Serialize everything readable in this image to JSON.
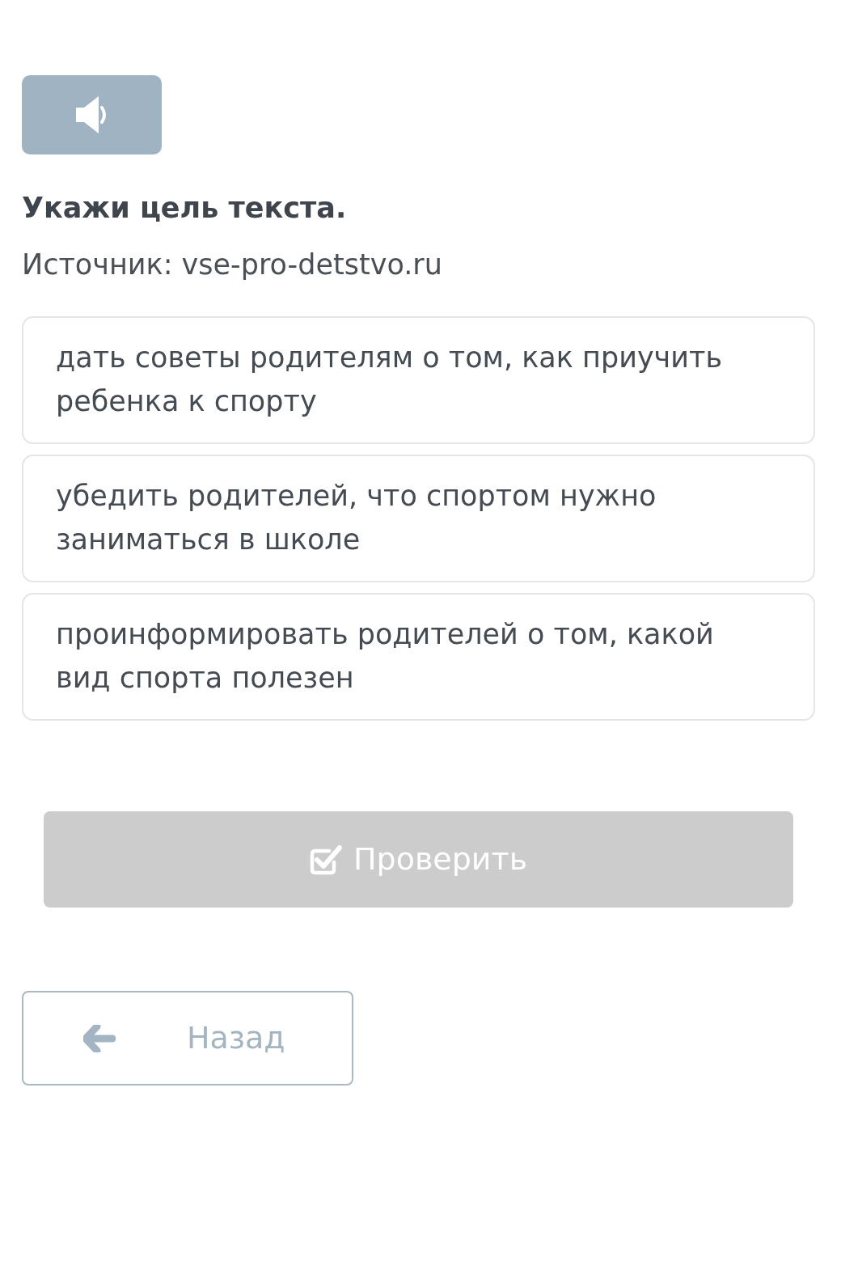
{
  "question": {
    "prompt": "Укажи цель текста.",
    "source": "Источник: vse-pro-detstvo.ru"
  },
  "options": [
    {
      "text": "дать советы родителям о том, как приучить ребенка к спорту",
      "selected": false
    },
    {
      "text": "убедить родителей, что спортом нужно заниматься в школе",
      "selected": false
    },
    {
      "text": "проинформировать родителей о том, какой вид спорта полезен",
      "selected": false
    }
  ],
  "check_button": {
    "label": "Проверить",
    "disabled": true
  },
  "back_button": {
    "label": "Назад"
  }
}
